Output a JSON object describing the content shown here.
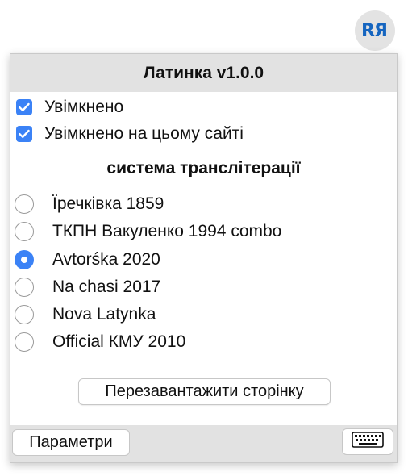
{
  "toolbar": {
    "extension_icon": "latynka-extension-icon"
  },
  "popup": {
    "title": "Латинка v1.0.0",
    "checkboxes": [
      {
        "label": "Увімкнено",
        "checked": true
      },
      {
        "label": "Увімкнено на цьому сайті",
        "checked": true
      }
    ],
    "section_title": "система транслітерації",
    "options": [
      {
        "label": "Їречківка 1859",
        "selected": false
      },
      {
        "label": "ТКПН Вакуленко 1994 combo",
        "selected": false
      },
      {
        "label": "Avtorśka 2020",
        "selected": true
      },
      {
        "label": "Na chasi 2017",
        "selected": false
      },
      {
        "label": "Nova Latynka",
        "selected": false
      },
      {
        "label": "Official КМУ 2010",
        "selected": false
      }
    ],
    "reload_label": "Перезавантажити сторінку",
    "footer": {
      "params_label": "Параметри",
      "keyboard_icon": "keyboard-icon"
    }
  },
  "colors": {
    "accent": "#3b82f6",
    "header_bg": "#e2e2e2"
  }
}
